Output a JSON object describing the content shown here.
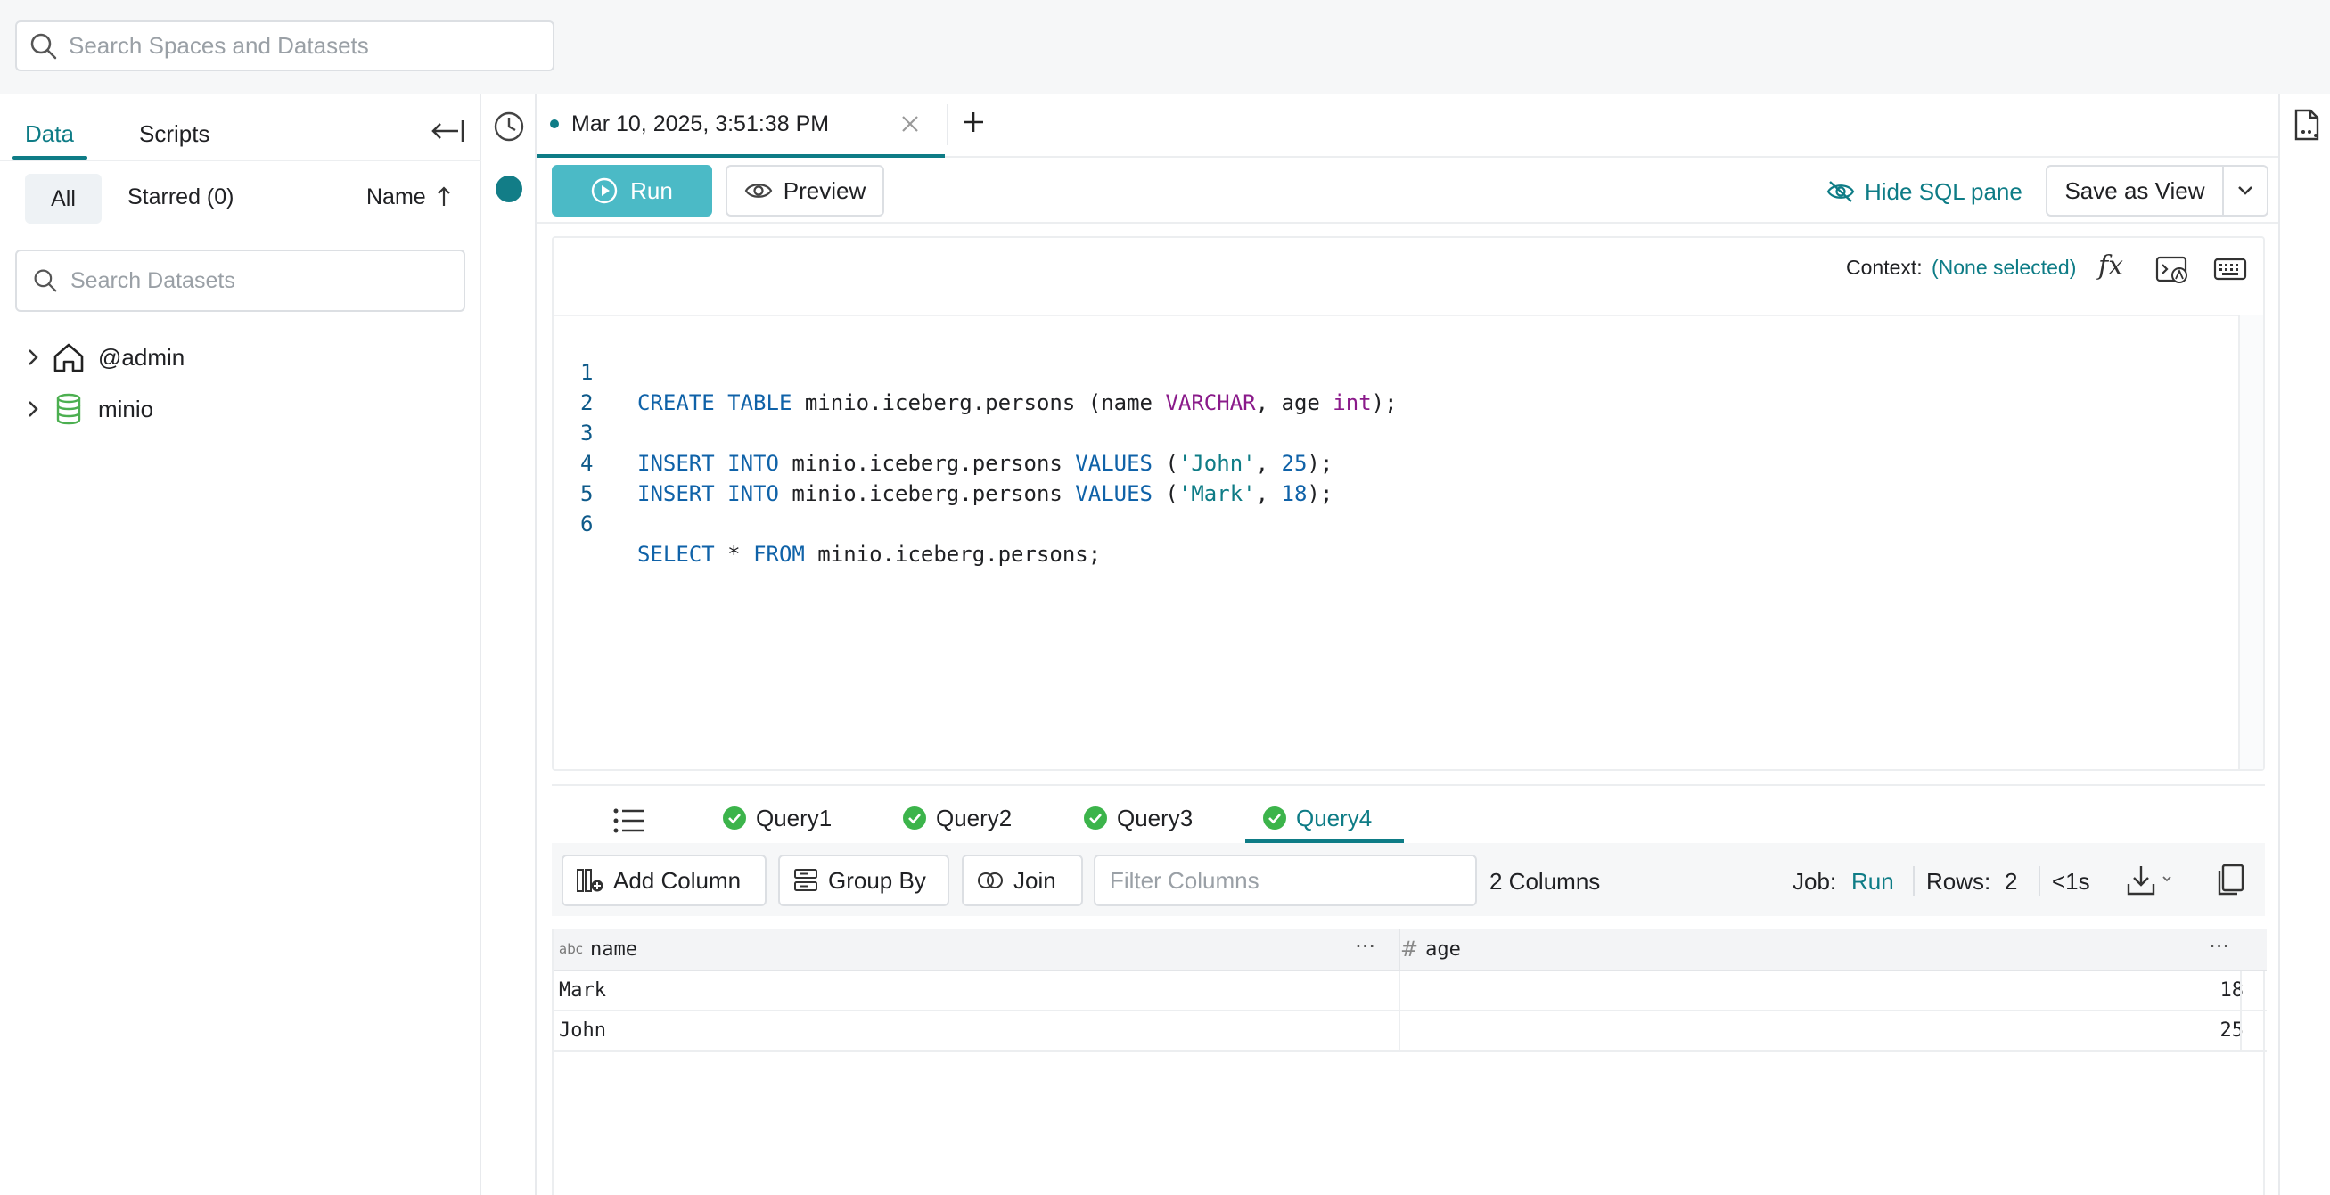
{
  "search": {
    "placeholder": "Search Spaces and Datasets"
  },
  "left_panel": {
    "tabs": [
      "Data",
      "Scripts"
    ],
    "filters": {
      "all": "All",
      "starred": "Starred (0)",
      "sort": "Name"
    },
    "dataset_search_placeholder": "Search Datasets",
    "tree": [
      {
        "label": "@admin",
        "icon": "home-icon"
      },
      {
        "label": "minio",
        "icon": "database-icon"
      }
    ]
  },
  "tab": {
    "title": "Mar 10, 2025, 3:51:38 PM"
  },
  "toolbar": {
    "run": "Run",
    "preview": "Preview",
    "hide_sql": "Hide SQL pane",
    "save_view": "Save as View"
  },
  "editor": {
    "context_label": "Context:",
    "context_value": "(None selected)",
    "line_numbers": [
      "1",
      "2",
      "3",
      "4",
      "5",
      "6"
    ],
    "lines": [
      "CREATE TABLE minio.iceberg.persons (name VARCHAR, age int);",
      "",
      "INSERT INTO minio.iceberg.persons VALUES ('John', 25);",
      "INSERT INTO minio.iceberg.persons VALUES ('Mark', 18);",
      "",
      "SELECT * FROM minio.iceberg.persons;"
    ]
  },
  "results": {
    "query_tabs": [
      "Query1",
      "Query2",
      "Query3",
      "Query4"
    ],
    "active_tab": "Query4",
    "toolbar": {
      "add_column": "Add Column",
      "group_by": "Group By",
      "join": "Join",
      "filter_placeholder": "Filter Columns",
      "column_count": "2 Columns",
      "job_label": "Job:",
      "job_value": "Run",
      "rows_label": "Rows:",
      "rows_value": "2",
      "time": "<1s"
    },
    "columns": [
      {
        "name": "name",
        "type_label": "abc"
      },
      {
        "name": "age",
        "type_label": "#"
      }
    ],
    "rows": [
      {
        "name": "Mark",
        "age": "18"
      },
      {
        "name": "John",
        "age": "25"
      }
    ]
  },
  "colors": {
    "accent": "#0e7c86",
    "run_button": "#4bbac6",
    "success": "#3cb44b"
  }
}
